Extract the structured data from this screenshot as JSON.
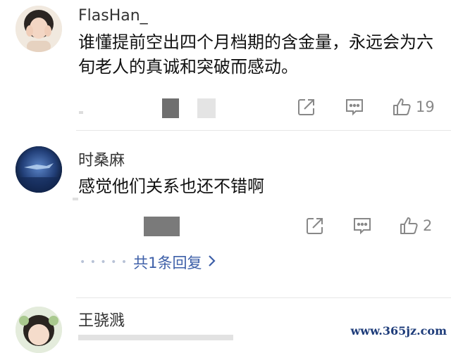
{
  "comments": [
    {
      "username": "FlasHan_",
      "content": "谁懂提前空出四个月档期的含金量，永远会为六旬老人的真诚和突破而感动。",
      "like_count": "19"
    },
    {
      "username": "时桑麻",
      "content": "感觉他们关系也还不错啊",
      "like_count": "2",
      "replies_label": "共1条回复"
    },
    {
      "username": "王骁溅"
    }
  ],
  "watermark": "www.365jz.com",
  "colors": {
    "link": "#3d5fa8",
    "icon": "#888888",
    "divider": "#e6e6e6"
  },
  "icons": [
    "share-icon",
    "comment-icon",
    "like-icon",
    "chevron-right-icon"
  ]
}
